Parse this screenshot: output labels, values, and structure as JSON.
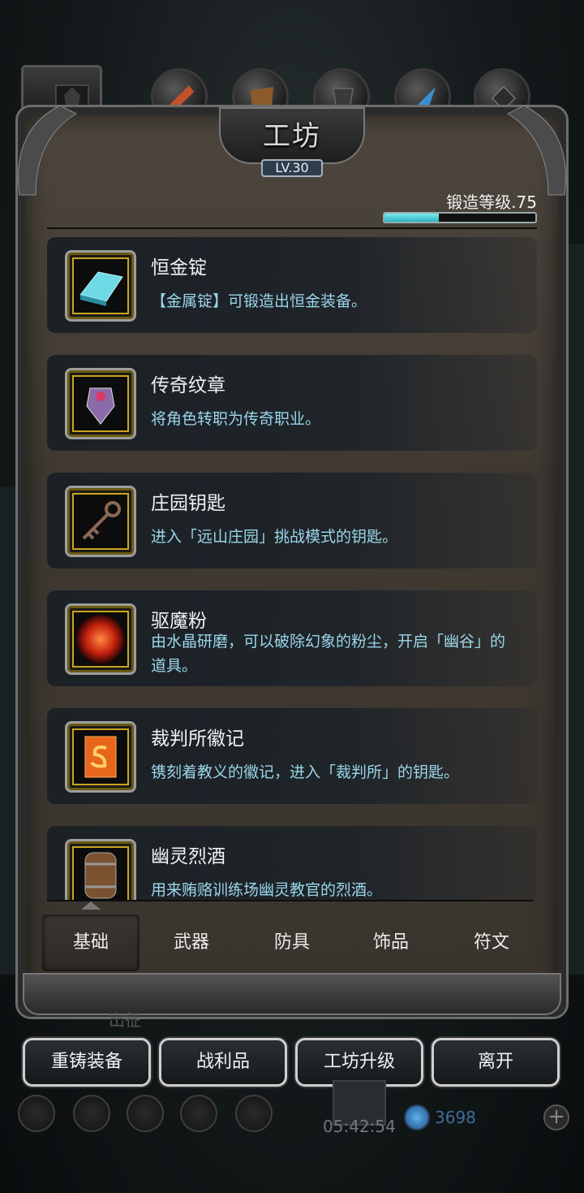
{
  "header": {
    "title": "工坊",
    "level": "LV.30",
    "forge_label": "锻造等级.75",
    "forge_progress": 0.36
  },
  "top_tabs": [
    "portrait-icon",
    "axe-icon",
    "shield-icon",
    "armor-icon",
    "feather-icon",
    "rune-icon"
  ],
  "items": [
    {
      "title": "恒金锭",
      "desc": "【金属锭】可锻造出恒金装备。",
      "icon": "ingot-icon"
    },
    {
      "title": "传奇纹章",
      "desc": "将角色转职为传奇职业。",
      "icon": "crest-icon"
    },
    {
      "title": "庄园钥匙",
      "desc": "进入「远山庄园」挑战模式的钥匙。",
      "icon": "key-icon"
    },
    {
      "title": "驱魔粉",
      "desc": "由水晶研磨，可以破除幻象的粉尘，开启「幽谷」的道具。",
      "icon": "powder-icon"
    },
    {
      "title": "裁判所徽记",
      "desc": "镌刻着教义的徽记，进入「裁判所」的钥匙。",
      "icon": "emblem-icon"
    },
    {
      "title": "幽灵烈酒",
      "desc": "用来贿赂训练场幽灵教官的烈酒。",
      "icon": "barrel-icon"
    }
  ],
  "tabs": [
    "基础",
    "武器",
    "防具",
    "饰品",
    "符文"
  ],
  "active_tab": 0,
  "background_label": "出征",
  "buttons": [
    "重铸装备",
    "战利品",
    "工坊升级",
    "离开"
  ],
  "footer": {
    "timer": "05:42:54",
    "gems": "3698"
  },
  "colors": {
    "accent_cyan": "#2ab5c2",
    "desc_text": "#9ad6ea",
    "frame_gold": "#c9a51e"
  }
}
